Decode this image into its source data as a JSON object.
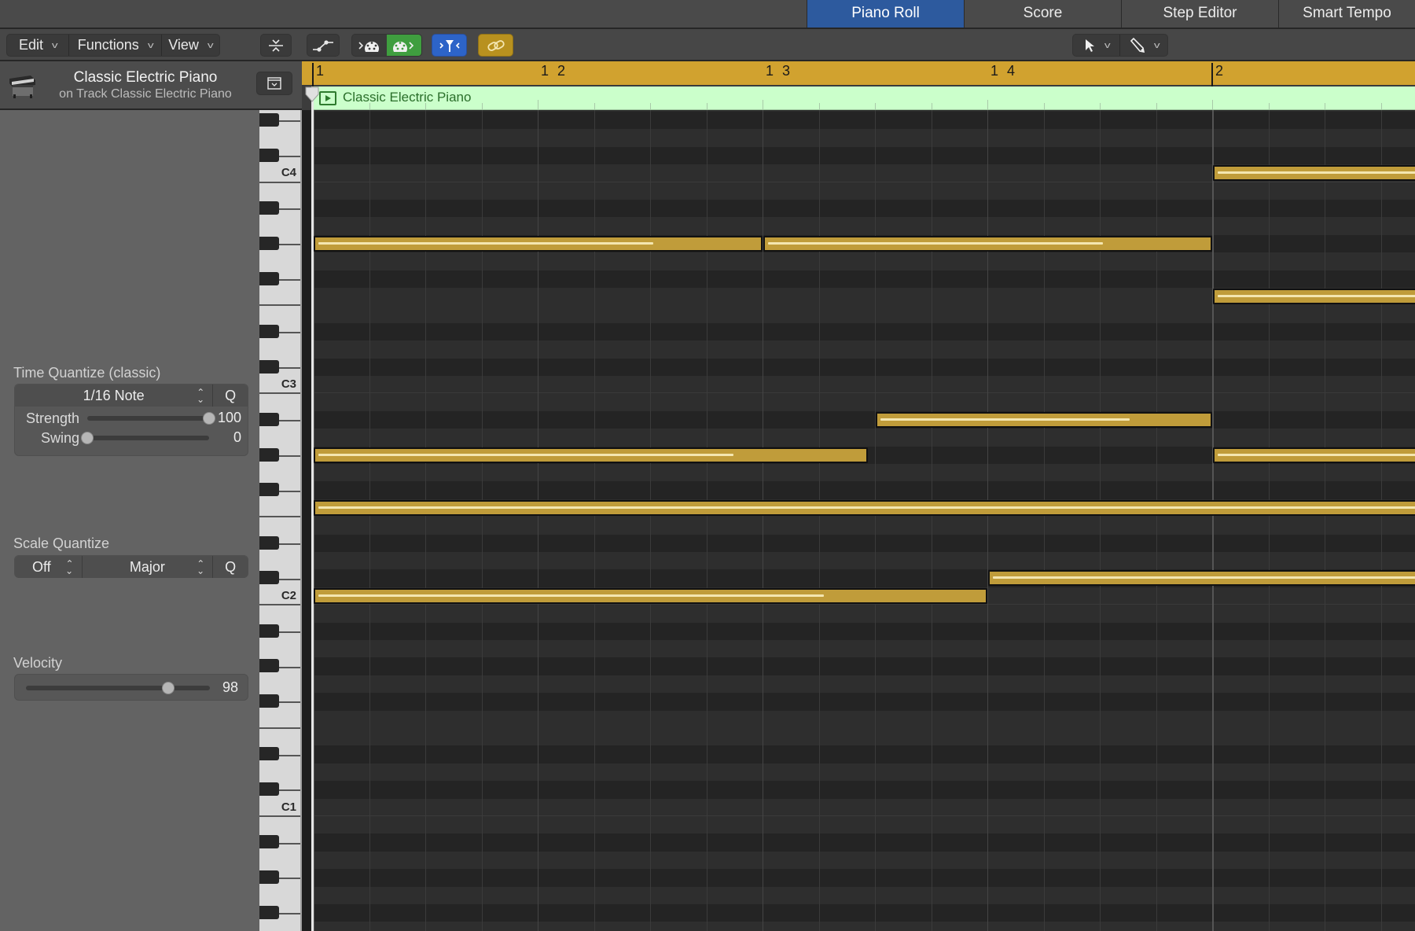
{
  "tabs": [
    {
      "label": "Piano Roll",
      "active": true
    },
    {
      "label": "Score",
      "active": false
    },
    {
      "label": "Step Editor",
      "active": false
    },
    {
      "label": "Smart Tempo",
      "active": false
    }
  ],
  "toolbar": {
    "menus": [
      "Edit",
      "Functions",
      "View"
    ],
    "icons": {
      "collapse": "collapse-vertical-icon",
      "automation": "automation-curve-icon",
      "midi_in": "midi-in-icon",
      "midi_out": "midi-out-icon",
      "catch": "catch-playhead-icon",
      "link": "link-icon",
      "pointer_tool": "pointer-tool-icon",
      "pencil_tool": "pencil-tool-icon"
    },
    "colors": {
      "midi_out_active": "#3f9e3f",
      "catch_active": "#2d64c8",
      "link_active": "#b8911f"
    }
  },
  "inspector": {
    "title": "Classic Electric Piano",
    "subtitle": "on Track Classic Electric Piano",
    "time_quantize": {
      "label": "Time Quantize (classic)",
      "value": "1/16 Note",
      "q_button": "Q",
      "strength": {
        "label": "Strength",
        "value": "100",
        "fraction": 1.0
      },
      "swing": {
        "label": "Swing",
        "value": "0",
        "fraction": 0.0
      }
    },
    "scale_quantize": {
      "label": "Scale Quantize",
      "root": "Off",
      "scale": "Major",
      "q_button": "Q"
    },
    "velocity": {
      "label": "Velocity",
      "value": "98",
      "fraction": 0.772
    }
  },
  "ruler": {
    "marks": [
      {
        "label": "1",
        "beat": 0
      },
      {
        "label": "1 2",
        "beat": 1
      },
      {
        "label": "1 3",
        "beat": 2
      },
      {
        "label": "1 4",
        "beat": 3
      },
      {
        "label": "2",
        "beat": 4
      }
    ],
    "color": "#d1a22f"
  },
  "region": {
    "name": "Classic Electric Piano",
    "color": "#cbffcb"
  },
  "keyboard": {
    "labels": [
      "C4",
      "C3",
      "C2",
      "C1"
    ],
    "top_pitch": "D#4"
  },
  "notes": [
    {
      "pitch": "C4",
      "start_beat": 4.0,
      "end_beat": 5.0,
      "velocity_fraction": 1.0
    },
    {
      "pitch": "G#3",
      "start_beat": 0.0,
      "end_beat": 2.0,
      "velocity_fraction": 0.76
    },
    {
      "pitch": "G#3",
      "start_beat": 2.0,
      "end_beat": 4.0,
      "velocity_fraction": 0.76
    },
    {
      "pitch": "F3",
      "start_beat": 4.0,
      "end_beat": 5.0,
      "velocity_fraction": 1.0
    },
    {
      "pitch": "A#2",
      "start_beat": 2.5,
      "end_beat": 4.0,
      "velocity_fraction": 0.76
    },
    {
      "pitch": "G#2",
      "start_beat": 0.0,
      "end_beat": 2.47,
      "velocity_fraction": 0.76
    },
    {
      "pitch": "G#2",
      "start_beat": 4.0,
      "end_beat": 5.0,
      "velocity_fraction": 1.0
    },
    {
      "pitch": "F2",
      "start_beat": 0.0,
      "end_beat": 5.0,
      "velocity_fraction": 1.0
    },
    {
      "pitch": "C#2",
      "start_beat": 3.0,
      "end_beat": 5.0,
      "velocity_fraction": 1.0
    },
    {
      "pitch": "C2",
      "start_beat": 0.0,
      "end_beat": 3.0,
      "velocity_fraction": 0.76
    }
  ],
  "colors": {
    "note": "#c09c3a",
    "note_velocity_line": "#f4e6b0",
    "tab_active": "#2d5a9e"
  }
}
